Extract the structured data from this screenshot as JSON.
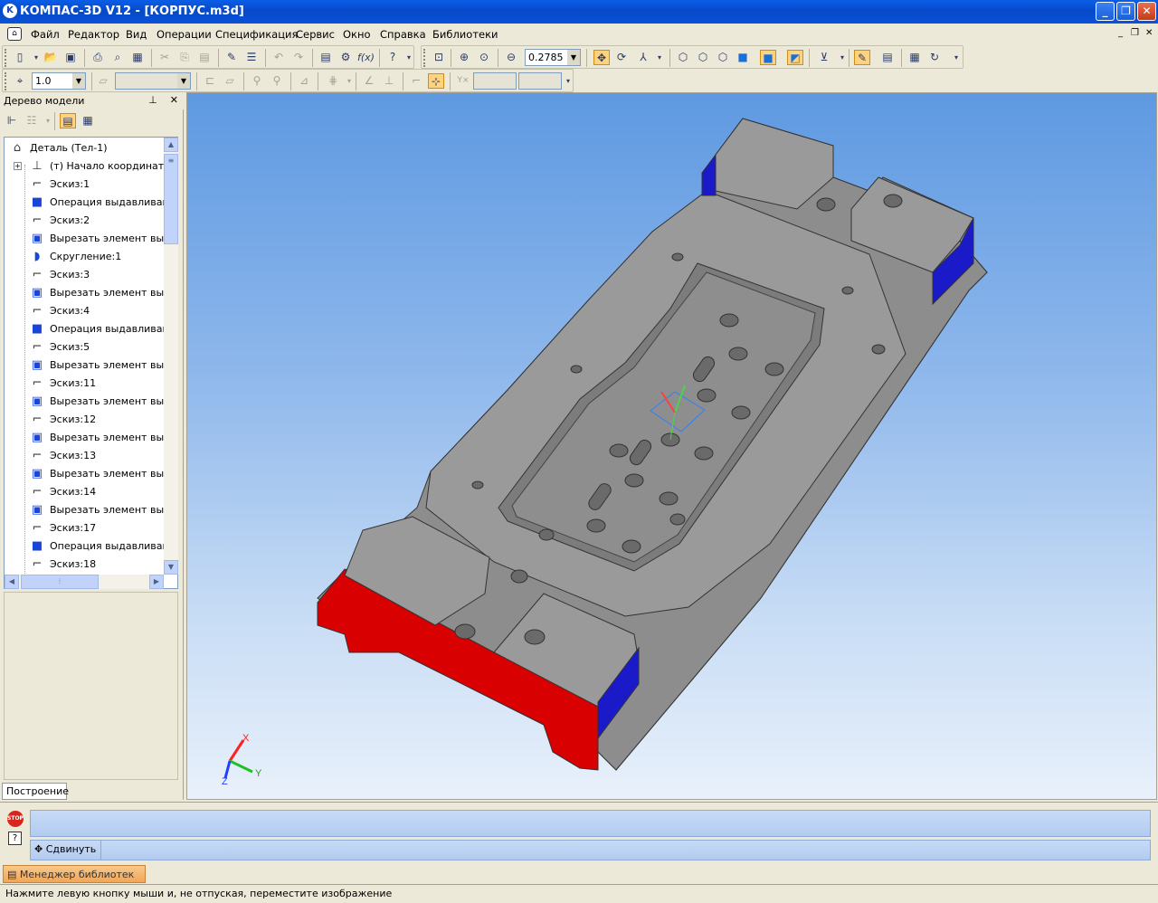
{
  "window": {
    "title": "КОМПАС-3D V12 - [КОРПУС.m3d]",
    "minimize": "_",
    "maximize": "❐",
    "close": "✕"
  },
  "menu": [
    "Файл",
    "Редактор",
    "Вид",
    "Операции",
    "Спецификация",
    "Сервис",
    "Окно",
    "Справка",
    "Библиотеки"
  ],
  "toolbar": {
    "zoom_value": "0.2785",
    "line_width": "1.0"
  },
  "tree_panel": {
    "title": "Дерево модели",
    "pin": "⊥",
    "close": "✕",
    "tab": "Построение",
    "items": [
      {
        "label": "Деталь (Тел-1)",
        "icon": "part-icon"
      },
      {
        "label": "(т) Начало координат",
        "icon": "origin-icon"
      },
      {
        "label": "Эскиз:1",
        "icon": "sketch-icon"
      },
      {
        "label": "Операция выдавливани",
        "icon": "extrude-icon"
      },
      {
        "label": "Эскиз:2",
        "icon": "sketch-icon"
      },
      {
        "label": "Вырезать элемент выд",
        "icon": "cut-icon"
      },
      {
        "label": "Скругление:1",
        "icon": "fillet-icon"
      },
      {
        "label": "Эскиз:3",
        "icon": "sketch-icon"
      },
      {
        "label": "Вырезать элемент выд",
        "icon": "cut-icon"
      },
      {
        "label": "Эскиз:4",
        "icon": "sketch-icon"
      },
      {
        "label": "Операция выдавливани",
        "icon": "extrude-icon"
      },
      {
        "label": "Эскиз:5",
        "icon": "sketch-icon"
      },
      {
        "label": "Вырезать элемент выд",
        "icon": "cut-icon"
      },
      {
        "label": "Эскиз:11",
        "icon": "sketch-icon"
      },
      {
        "label": "Вырезать элемент выд",
        "icon": "cut-icon"
      },
      {
        "label": "Эскиз:12",
        "icon": "sketch-icon"
      },
      {
        "label": "Вырезать элемент выд",
        "icon": "cut-icon"
      },
      {
        "label": "Эскиз:13",
        "icon": "sketch-icon"
      },
      {
        "label": "Вырезать элемент выд",
        "icon": "cut-icon"
      },
      {
        "label": "Эскиз:14",
        "icon": "sketch-icon"
      },
      {
        "label": "Вырезать элемент выд",
        "icon": "cut-icon"
      },
      {
        "label": "Эскиз:17",
        "icon": "sketch-icon"
      },
      {
        "label": "Операция выдавливани",
        "icon": "extrude-icon"
      },
      {
        "label": "Эскиз:18",
        "icon": "sketch-icon"
      }
    ]
  },
  "axes": {
    "x": "X",
    "y": "Y",
    "z": "Z"
  },
  "command": {
    "stop": "STOP",
    "help": "?",
    "move_label": "Сдвинуть"
  },
  "library": {
    "tab": "Менеджер библиотек"
  },
  "status": "Нажмите левую кнопку мыши и, не отпуская, переместите изображение"
}
